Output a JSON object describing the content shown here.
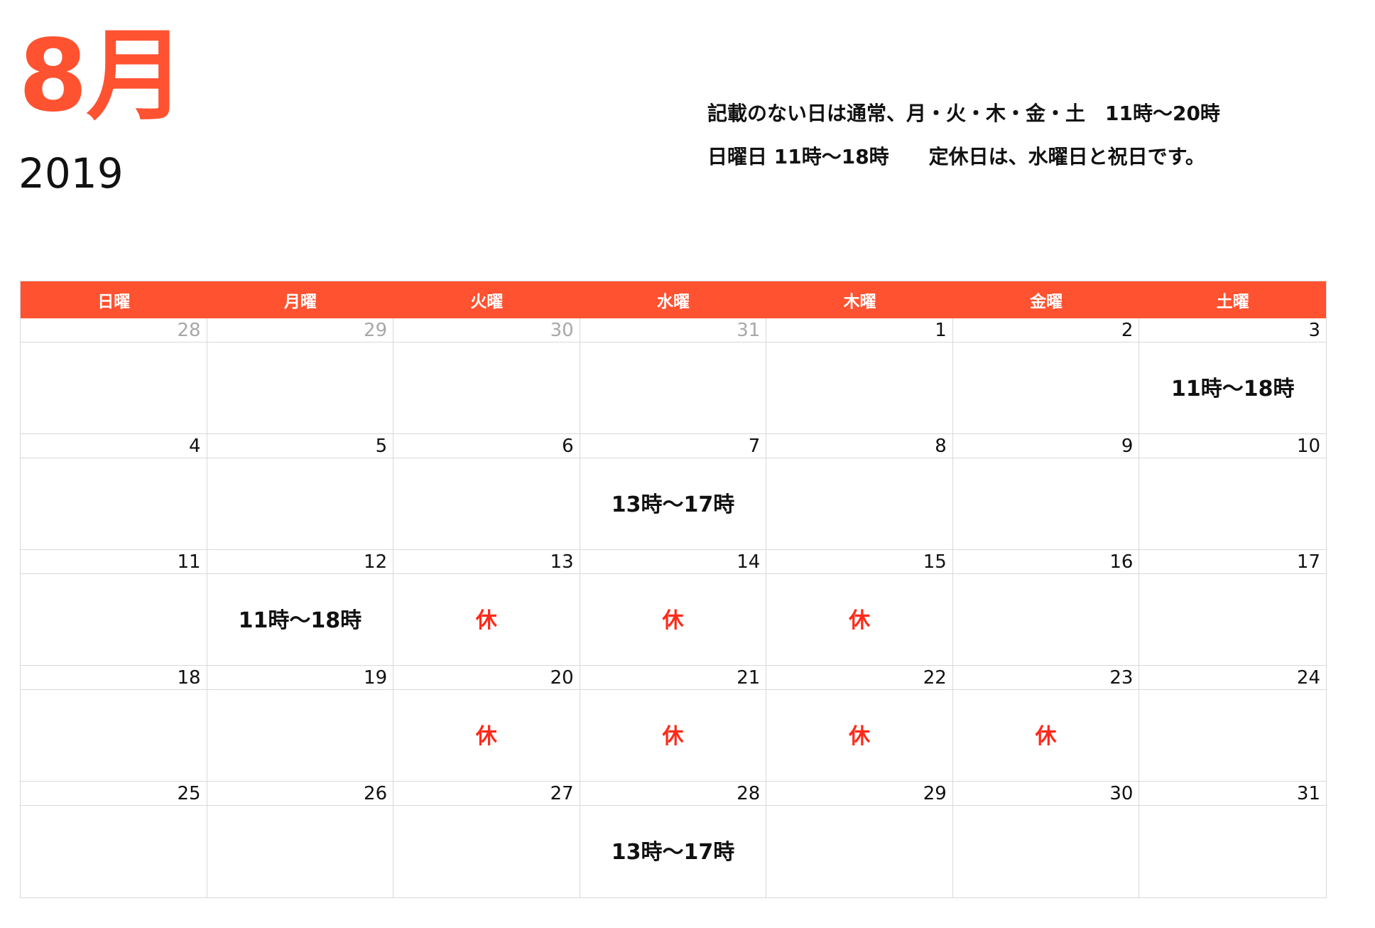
{
  "header": {
    "month": "8月",
    "year": "2019",
    "note_line1": "記載のない日は通常、月・火・木・金・土　11時〜20時",
    "note_line2": "日曜日 11時〜18時　　定休日は、水曜日と祝日です。"
  },
  "colors": {
    "accent": "#ff5230",
    "closed": "#ff2a1a",
    "muted": "#a8a8a8",
    "grid": "#d9d9d9"
  },
  "calendar": {
    "weekdays": [
      "日曜",
      "月曜",
      "火曜",
      "水曜",
      "木曜",
      "金曜",
      "土曜"
    ],
    "weeks": [
      [
        {
          "date": "28",
          "other": true,
          "event": ""
        },
        {
          "date": "29",
          "other": true,
          "event": ""
        },
        {
          "date": "30",
          "other": true,
          "event": ""
        },
        {
          "date": "31",
          "other": true,
          "event": ""
        },
        {
          "date": "1",
          "other": false,
          "event": ""
        },
        {
          "date": "2",
          "other": false,
          "event": ""
        },
        {
          "date": "3",
          "other": false,
          "event": "11時〜18時"
        }
      ],
      [
        {
          "date": "4",
          "other": false,
          "event": ""
        },
        {
          "date": "5",
          "other": false,
          "event": ""
        },
        {
          "date": "6",
          "other": false,
          "event": ""
        },
        {
          "date": "7",
          "other": false,
          "event": "13時〜17時"
        },
        {
          "date": "8",
          "other": false,
          "event": ""
        },
        {
          "date": "9",
          "other": false,
          "event": ""
        },
        {
          "date": "10",
          "other": false,
          "event": ""
        }
      ],
      [
        {
          "date": "11",
          "other": false,
          "event": ""
        },
        {
          "date": "12",
          "other": false,
          "event": "11時〜18時"
        },
        {
          "date": "13",
          "other": false,
          "event": "休",
          "closed": true
        },
        {
          "date": "14",
          "other": false,
          "event": "休",
          "closed": true
        },
        {
          "date": "15",
          "other": false,
          "event": "休",
          "closed": true
        },
        {
          "date": "16",
          "other": false,
          "event": ""
        },
        {
          "date": "17",
          "other": false,
          "event": ""
        }
      ],
      [
        {
          "date": "18",
          "other": false,
          "event": ""
        },
        {
          "date": "19",
          "other": false,
          "event": ""
        },
        {
          "date": "20",
          "other": false,
          "event": "休",
          "closed": true
        },
        {
          "date": "21",
          "other": false,
          "event": "休",
          "closed": true
        },
        {
          "date": "22",
          "other": false,
          "event": "休",
          "closed": true
        },
        {
          "date": "23",
          "other": false,
          "event": "休",
          "closed": true
        },
        {
          "date": "24",
          "other": false,
          "event": ""
        }
      ],
      [
        {
          "date": "25",
          "other": false,
          "event": ""
        },
        {
          "date": "26",
          "other": false,
          "event": ""
        },
        {
          "date": "27",
          "other": false,
          "event": ""
        },
        {
          "date": "28",
          "other": false,
          "event": "13時〜17時"
        },
        {
          "date": "29",
          "other": false,
          "event": ""
        },
        {
          "date": "30",
          "other": false,
          "event": ""
        },
        {
          "date": "31",
          "other": false,
          "event": ""
        }
      ]
    ]
  }
}
